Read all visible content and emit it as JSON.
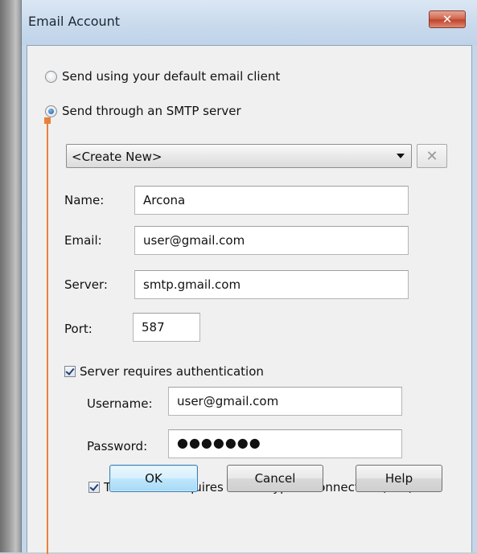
{
  "window": {
    "title": "Email Account",
    "close_glyph": "✕"
  },
  "options": {
    "default_client_label": "Send using your default email client",
    "smtp_label": "Send through an SMTP server",
    "selected": "smtp"
  },
  "account_combo": {
    "value": "<Create New>",
    "delete_glyph": "✕"
  },
  "fields": {
    "name_label": "Name:",
    "name_value": "Arcona",
    "email_label": "Email:",
    "email_value": "user@gmail.com",
    "server_label": "Server:",
    "server_value": "smtp.gmail.com",
    "port_label": "Port:",
    "port_value": "587"
  },
  "auth": {
    "requires_auth_label": "Server requires authentication",
    "requires_auth_checked": true,
    "username_label": "Username:",
    "username_value": "user@gmail.com",
    "password_label": "Password:",
    "password_masked": "●●●●●●●"
  },
  "ssl": {
    "label": "This server requires an encrypted connection (SSL)",
    "checked": true
  },
  "buttons": {
    "ok": "OK",
    "cancel": "Cancel",
    "help": "Help"
  },
  "colors": {
    "accent_line": "#e9813a",
    "close_button": "#c4432a",
    "default_button_border": "#3c7fb1"
  }
}
